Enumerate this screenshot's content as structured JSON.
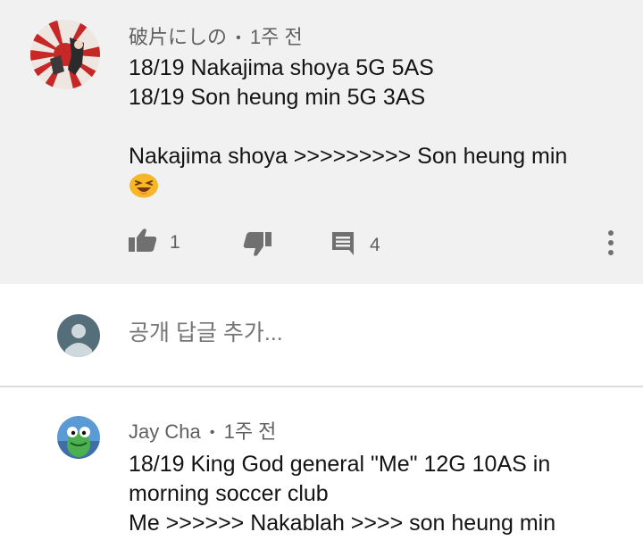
{
  "comment1": {
    "author": "破片にしの",
    "separator": "•",
    "time": "1주 전",
    "lines": [
      "18/19 Nakajima shoya 5G 5AS",
      "18/19 Son heung min 5G 3AS",
      "Nakajima shoya >>>>>>>>> Son heung min"
    ],
    "emoji": "laughing-face-emoji",
    "like_count": "1",
    "reply_count": "4",
    "icons": {
      "like": "thumbs-up-icon",
      "dislike": "thumbs-down-icon",
      "reply": "comment-icon",
      "more": "more-vertical-icon"
    }
  },
  "reply_box": {
    "placeholder": "공개 답글 추가..."
  },
  "comment2": {
    "author": "Jay Cha",
    "separator": "•",
    "time": "1주 전",
    "lines": [
      "18/19 King God general \"Me\" 12G 10AS in",
      "morning soccer club",
      "Me >>>>>> Nakablah >>>> son heung min"
    ]
  },
  "colors": {
    "highlight_bg": "#f1f1f1",
    "text_primary": "#141414",
    "text_secondary": "#606060",
    "icon_gray": "#707070"
  }
}
